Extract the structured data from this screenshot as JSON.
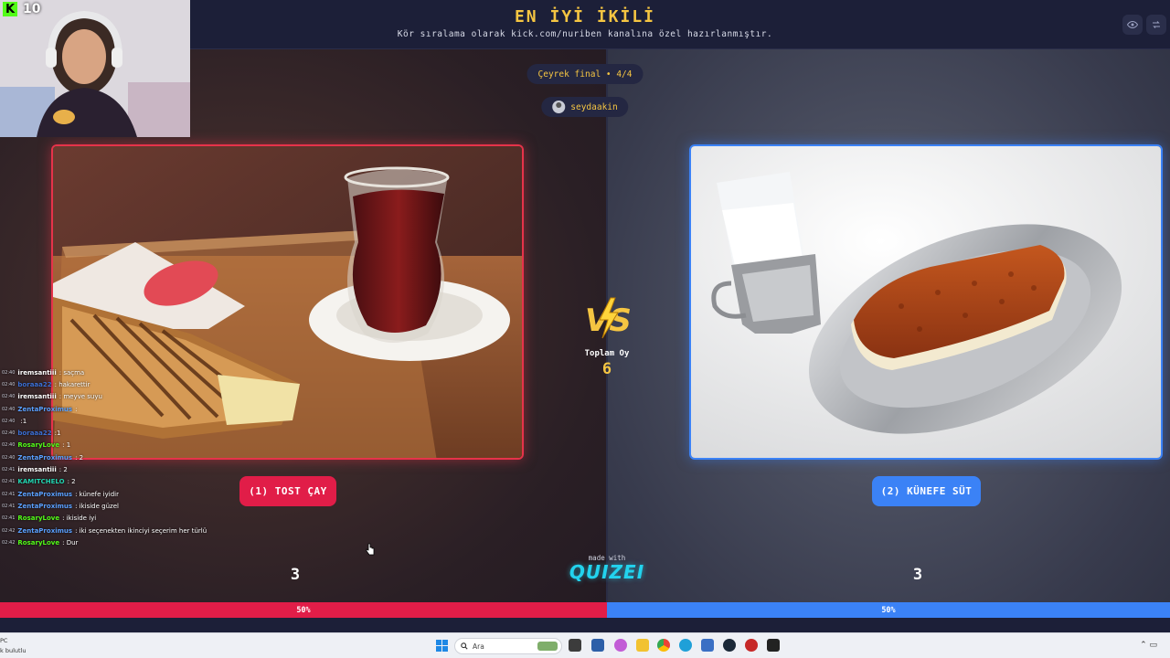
{
  "header": {
    "title": "EN İYİ İKİLİ",
    "subtitle": "Kör sıralama olarak kick.com/nuriben kanalına özel hazırlanmıştır."
  },
  "round": {
    "label": "Çeyrek final • 4/4"
  },
  "creator": {
    "name": "seydaakin"
  },
  "options": [
    {
      "label": "(1) TOST ÇAY",
      "votes": "3",
      "percent": "50%"
    },
    {
      "label": "(2) KÜNEFE SÜT",
      "votes": "3",
      "percent": "50%"
    }
  ],
  "totals": {
    "label": "Toplam Oy",
    "value": "6"
  },
  "footer": {
    "made_with": "made with",
    "brand": "QUIZEI"
  },
  "stream": {
    "viewer_count": "10"
  },
  "chat": [
    {
      "time": "02:40",
      "user": "iremsantiii",
      "msg": ": saçma",
      "color": "#ffffff"
    },
    {
      "time": "02:40",
      "user": "boraaa22",
      "msg": ": hakarettir",
      "color": "#3b6fd4"
    },
    {
      "time": "02:40",
      "user": "iremsantiii",
      "msg": ": meyve suyu",
      "color": "#ffffff"
    },
    {
      "time": "02:40",
      "user": "ZentaProximus",
      "msg": ":",
      "color": "#5aa0ff"
    },
    {
      "time": "02:40",
      "user": "",
      "msg": ":1",
      "color": "#e0245e"
    },
    {
      "time": "02:40",
      "user": "boraaa22",
      "msg": ":1",
      "color": "#3b6fd4"
    },
    {
      "time": "02:40",
      "user": "RosaryLove",
      "msg": ": 1",
      "color": "#53fc18"
    },
    {
      "time": "02:40",
      "user": "ZentaProximus",
      "msg": ": 2",
      "color": "#5aa0ff"
    },
    {
      "time": "02:41",
      "user": "iremsantiii",
      "msg": ": 2",
      "color": "#ffffff"
    },
    {
      "time": "02:41",
      "user": "KAMITCHELO",
      "msg": ": 2",
      "color": "#22d3b0"
    },
    {
      "time": "02:41",
      "user": "ZentaProximus",
      "msg": ": künefe iyidir",
      "color": "#5aa0ff"
    },
    {
      "time": "02:41",
      "user": "ZentaProximus",
      "msg": ": ikiside güzel",
      "color": "#5aa0ff"
    },
    {
      "time": "02:41",
      "user": "RosaryLove",
      "msg": ": ikiside iyi",
      "color": "#53fc18"
    },
    {
      "time": "02:42",
      "user": "ZentaProximus",
      "msg": ": iki seçenekten ikinciyi seçerim her türlü",
      "color": "#5aa0ff"
    },
    {
      "time": "02:42",
      "user": "RosaryLove",
      "msg": ": Dur",
      "color": "#53fc18"
    }
  ],
  "taskbar": {
    "search_placeholder": "Ara",
    "weather_line1": "PC",
    "weather_line2": "k bulutlu"
  }
}
